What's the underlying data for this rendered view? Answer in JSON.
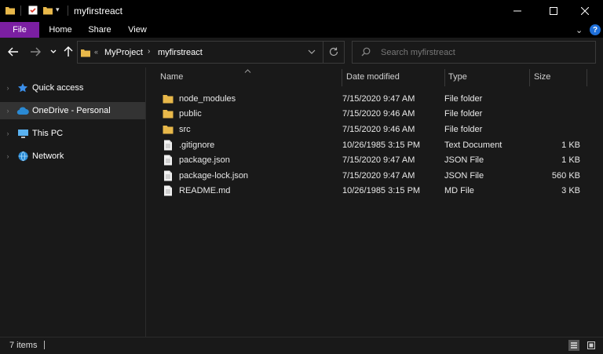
{
  "window": {
    "title": "myfirstreact"
  },
  "ribbon": {
    "tabs": [
      "File",
      "Home",
      "Share",
      "View"
    ]
  },
  "address": {
    "crumbs": [
      "MyProject",
      "myfirstreact"
    ]
  },
  "search": {
    "placeholder": "Search myfirstreact"
  },
  "nav": {
    "items": [
      {
        "label": "Quick access",
        "icon": "star-icon"
      },
      {
        "label": "OneDrive - Personal",
        "icon": "cloud-icon",
        "selected": true
      },
      {
        "label": "This PC",
        "icon": "computer-icon"
      },
      {
        "label": "Network",
        "icon": "network-icon"
      }
    ]
  },
  "columns": {
    "name": "Name",
    "date": "Date modified",
    "type": "Type",
    "size": "Size"
  },
  "files": [
    {
      "name": "node_modules",
      "date": "7/15/2020 9:47 AM",
      "type": "File folder",
      "size": "",
      "icon": "folder-icon"
    },
    {
      "name": "public",
      "date": "7/15/2020 9:46 AM",
      "type": "File folder",
      "size": "",
      "icon": "folder-icon"
    },
    {
      "name": "src",
      "date": "7/15/2020 9:46 AM",
      "type": "File folder",
      "size": "",
      "icon": "folder-icon"
    },
    {
      "name": ".gitignore",
      "date": "10/26/1985 3:15 PM",
      "type": "Text Document",
      "size": "1 KB",
      "icon": "file-icon"
    },
    {
      "name": "package.json",
      "date": "7/15/2020 9:47 AM",
      "type": "JSON File",
      "size": "1 KB",
      "icon": "file-icon"
    },
    {
      "name": "package-lock.json",
      "date": "7/15/2020 9:47 AM",
      "type": "JSON File",
      "size": "560 KB",
      "icon": "file-icon"
    },
    {
      "name": "README.md",
      "date": "10/26/1985 3:15 PM",
      "type": "MD File",
      "size": "3 KB",
      "icon": "file-icon"
    }
  ],
  "status": {
    "items": "7 items"
  },
  "colors": {
    "file_tab": "#7b1fa2",
    "folder": "#e8b84a",
    "help": "#1e6fd9",
    "background": "#191919"
  }
}
